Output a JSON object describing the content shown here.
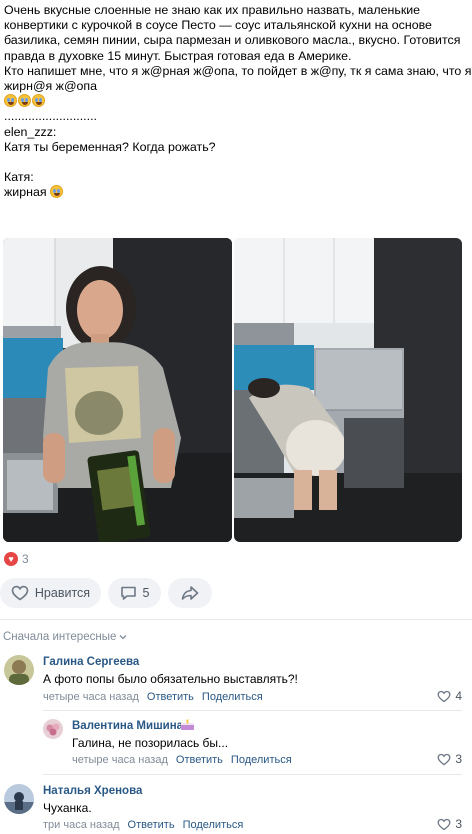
{
  "post": {
    "lines": [
      "Очень вкусные слоенные не знаю как их правильно назвать, маленькие",
      "конвертики с курочкой в соусе Песто — соус итальянской кухни на основе",
      "базилика, семян пинии, сыра пармезан и оливкового масла., вкусно. Готовится",
      "правда в духовке 15 минут. Быстрая готовая еда в Америке.",
      "Кто напишет мне, что я ж@рная ж@опа, то пойдет в ж@пу, тк я сама знаю, что я",
      "жирн@я ж@опа"
    ],
    "dots": "...........................",
    "quote_author": "elen_zzz:",
    "quote_text": "Катя ты беременная? Когда рожать?",
    "reply_author": "Катя:",
    "reply_text": "жирная"
  },
  "reactions": {
    "count": "3",
    "icon": "heart-icon",
    "color": "#e64646"
  },
  "actions": {
    "like_label": "Нравится",
    "comment_count": "5",
    "share_icon": "share-arrow-icon"
  },
  "comments_sort": "Сначала интересные",
  "comments": [
    {
      "name": "Галина Сергеева",
      "text": "А фото попы было обязательно выставлять?!",
      "time": "четыре часа назад",
      "reply": "Ответить",
      "share": "Поделиться",
      "likes": "4"
    },
    {
      "name": "Валентина Мишина",
      "text": "Галина, не позорилась бы...",
      "time": "четыре часа назад",
      "reply": "Ответить",
      "share": "Поделиться",
      "likes": "3"
    },
    {
      "name": "Наталья Хренова",
      "text": "Чуханка.",
      "time": "три часа назад",
      "reply": "Ответить",
      "share": "Поделиться",
      "likes": "3"
    }
  ],
  "colors": {
    "link": "#2a5885",
    "muted": "#818c99",
    "pill_bg": "#f0f2f5"
  }
}
